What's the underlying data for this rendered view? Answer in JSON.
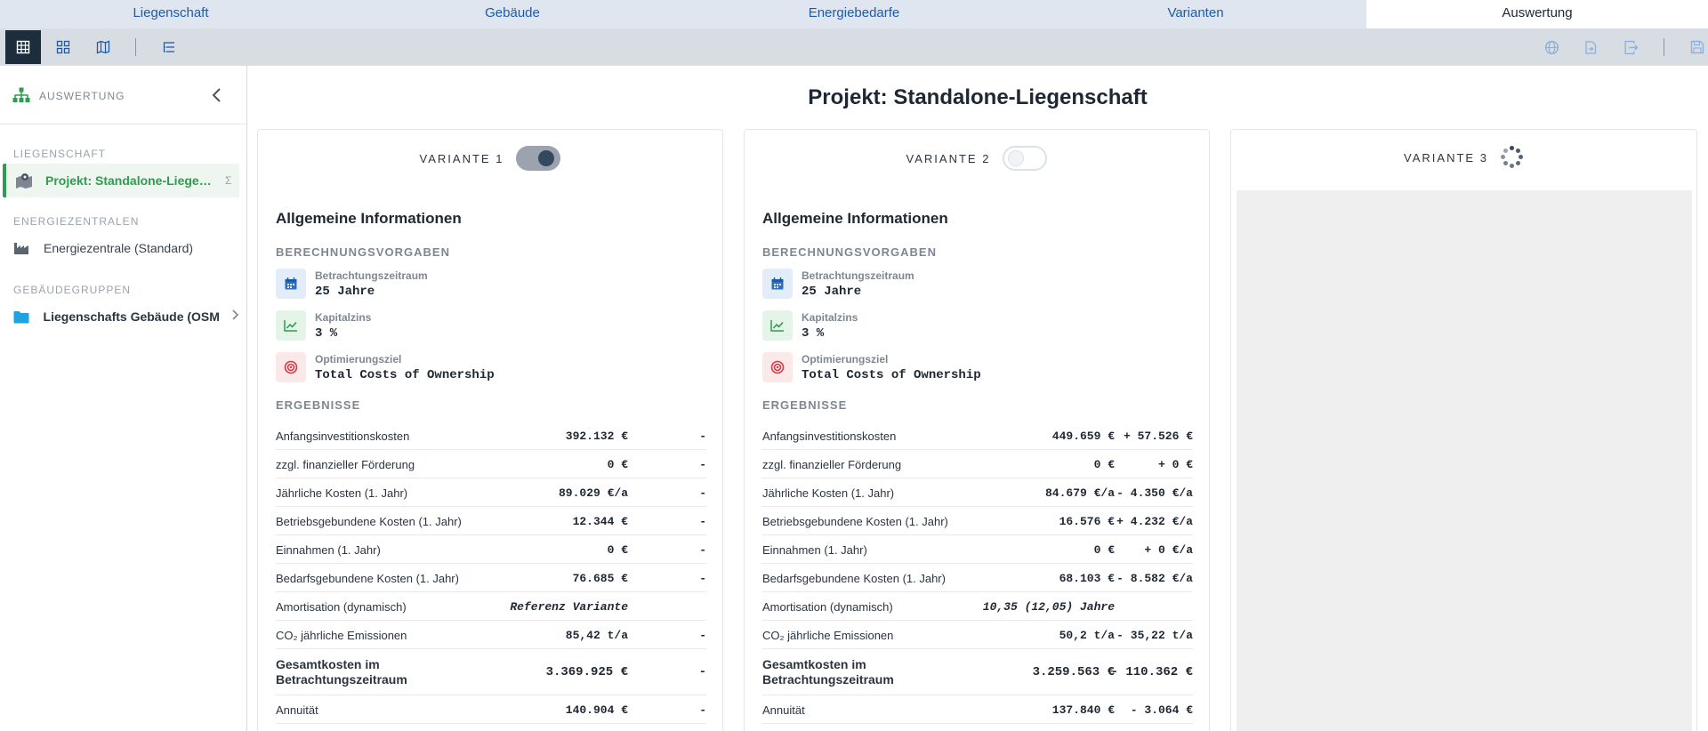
{
  "tabs": [
    "Liegenschaft",
    "Gebäude",
    "Energiebedarfe",
    "Varianten",
    "Auswertung"
  ],
  "active_tab": "Auswertung",
  "sidebar": {
    "header": "AUSWERTUNG",
    "sections": {
      "liegenschaft": "LIEGENSCHAFT",
      "energiezentralen": "ENERGIEZENTRALEN",
      "gebaeudegruppen": "GEBÄUDEGRUPPEN"
    },
    "items": {
      "projekt": "Projekt: Standalone-Liegenschaft",
      "projekt_suffix": "Σ",
      "energiezentrale": "Energiezentrale (Standard)",
      "gebaeude": "Liegenschafts Gebäude (OSM)"
    }
  },
  "page_title": "Projekt: Standalone-Liegenschaft",
  "variants": [
    {
      "title": "VARIANTE 1",
      "enabled": true,
      "section_title": "Allgemeine Informationen",
      "berechnung_label": "BERECHNUNGSVORGABEN",
      "specs": [
        {
          "label": "Betrachtungszeitraum",
          "value": "25 Jahre",
          "icon": "calendar-icon"
        },
        {
          "label": "Kapitalzins",
          "value": "3 %",
          "icon": "trend-chart-icon"
        },
        {
          "label": "Optimierungsziel",
          "value": "Total Costs of Ownership",
          "icon": "target-icon"
        }
      ],
      "ergebnisse_label": "ERGEBNISSE",
      "rows": [
        {
          "label": "Anfangsinvestitionskosten",
          "value": "392.132 €",
          "delta": "-"
        },
        {
          "label": "zzgl. finanzieller Förderung",
          "value": "0 €",
          "delta": "-"
        },
        {
          "label": "Jährliche Kosten (1. Jahr)",
          "value": "89.029 €/a",
          "delta": "-"
        },
        {
          "label": "Betriebsgebundene Kosten (1. Jahr)",
          "value": "12.344 €",
          "delta": "-"
        },
        {
          "label": "Einnahmen (1. Jahr)",
          "value": "0 €",
          "delta": "-"
        },
        {
          "label": "Bedarfsgebundene Kosten (1. Jahr)",
          "value": "76.685 €",
          "delta": "-"
        },
        {
          "label": "Amortisation (dynamisch)",
          "value": "Referenz Variante",
          "delta": ""
        },
        {
          "label": "CO₂ jährliche Emissionen",
          "value": "85,42 t/a",
          "delta": "-"
        },
        {
          "label": "Gesamtkosten im Betrachtungszeitraum",
          "value": "3.369.925 €",
          "delta": "-"
        },
        {
          "label": "Annuität",
          "value": "140.904 €",
          "delta": "-"
        }
      ]
    },
    {
      "title": "VARIANTE 2",
      "enabled": false,
      "section_title": "Allgemeine Informationen",
      "berechnung_label": "BERECHNUNGSVORGABEN",
      "specs": [
        {
          "label": "Betrachtungszeitraum",
          "value": "25 Jahre",
          "icon": "calendar-icon"
        },
        {
          "label": "Kapitalzins",
          "value": "3 %",
          "icon": "trend-chart-icon"
        },
        {
          "label": "Optimierungsziel",
          "value": "Total Costs of Ownership",
          "icon": "target-icon"
        }
      ],
      "ergebnisse_label": "ERGEBNISSE",
      "rows": [
        {
          "label": "Anfangsinvestitionskosten",
          "value": "449.659 €",
          "delta": "+ 57.526 €"
        },
        {
          "label": "zzgl. finanzieller Förderung",
          "value": "0 €",
          "delta": "+ 0 €"
        },
        {
          "label": "Jährliche Kosten (1. Jahr)",
          "value": "84.679 €/a",
          "delta": "- 4.350 €/a"
        },
        {
          "label": "Betriebsgebundene Kosten (1. Jahr)",
          "value": "16.576 €",
          "delta": "+ 4.232 €/a"
        },
        {
          "label": "Einnahmen (1. Jahr)",
          "value": "0 €",
          "delta": "+ 0 €/a"
        },
        {
          "label": "Bedarfsgebundene Kosten (1. Jahr)",
          "value": "68.103 €",
          "delta": "- 8.582 €/a"
        },
        {
          "label": "Amortisation (dynamisch)",
          "value": "10,35 (12,05) Jahre",
          "delta": ""
        },
        {
          "label": "CO₂ jährliche Emissionen",
          "value": "50,2 t/a",
          "delta": "- 35,22 t/a"
        },
        {
          "label": "Gesamtkosten im Betrachtungszeitraum",
          "value": "3.259.563 €",
          "delta": "- 110.362 €"
        },
        {
          "label": "Annuität",
          "value": "137.840 €",
          "delta": "- 3.064 €"
        }
      ]
    },
    {
      "title": "VARIANTE 3",
      "loading": true
    }
  ],
  "colors": {
    "accent_green": "#2f9c4f",
    "toolbar_active": "#1c2d3c",
    "tab_link": "#1f5aa8"
  }
}
